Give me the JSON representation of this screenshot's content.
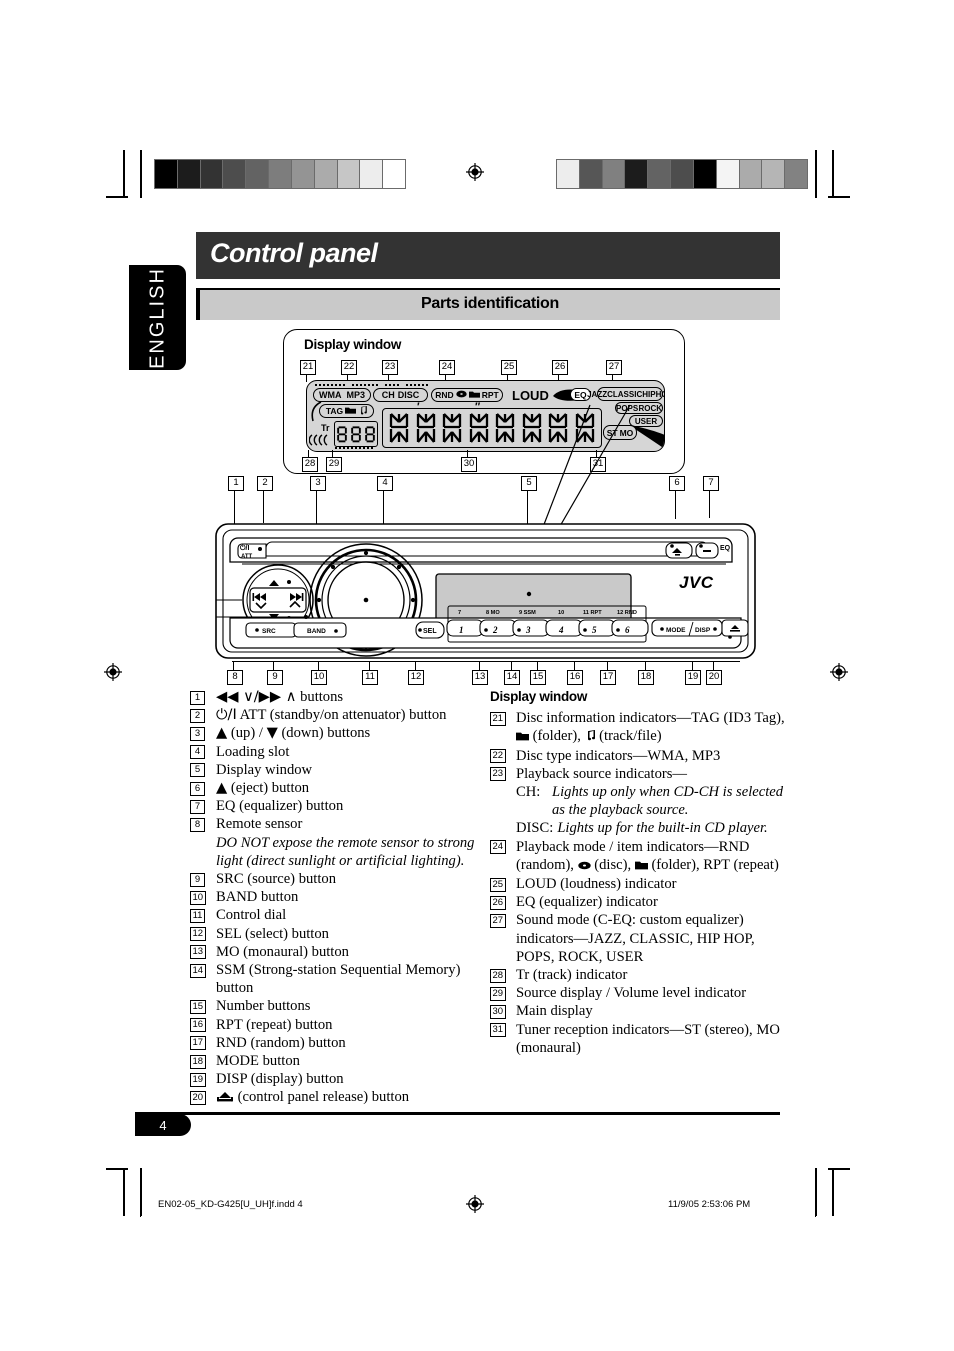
{
  "language_tab": "ENGLISH",
  "header": {
    "title": "Control panel",
    "section": "Parts identification"
  },
  "display_panel": {
    "heading": "Display window",
    "lcd": {
      "indicators_row1": [
        "WMA",
        "MP3",
        "CH",
        "DISC",
        "RND",
        "disc-icon",
        "folder-icon",
        "RPT",
        "LOUD",
        "EQ"
      ],
      "sound_modes": [
        "JAZZ",
        "CLASSIC",
        "HIPHOP",
        "POPS",
        "ROCK",
        "USER"
      ],
      "tag_row": [
        "TAG",
        "folder-icon",
        "note-icon"
      ],
      "track_label": "Tr",
      "source_digits": "888",
      "tuner_row": [
        "ST",
        "MO"
      ],
      "main_digits": "88:88.8888"
    },
    "callouts_top": [
      "21",
      "22",
      "23",
      "24",
      "25",
      "26",
      "27"
    ],
    "callouts_bottom": [
      "28",
      "29",
      "30",
      "31"
    ]
  },
  "faceplate": {
    "callouts_top": [
      "1",
      "2",
      "3",
      "4",
      "5",
      "6",
      "7"
    ],
    "callouts_bottom": [
      "8",
      "9",
      "10",
      "11",
      "12",
      "13",
      "14",
      "15",
      "16",
      "17",
      "18",
      "19",
      "20"
    ],
    "brand": "JVC",
    "power_label_top": "⏻/I",
    "power_label_bottom": "ATT",
    "eq_label": "EQ",
    "sel_label": "SEL",
    "src_label": "SRC",
    "band_label": "BAND",
    "mode_label": "MODE",
    "disp_label": "DISP",
    "preset_numbers": [
      "1",
      "2",
      "3",
      "4",
      "5",
      "6"
    ],
    "preset_upper_labels": [
      "7",
      "8  MO",
      "9  SSM",
      "10",
      "11  RPT",
      "12  RND"
    ]
  },
  "left_list": [
    {
      "n": "1",
      "text": "◀◀ ∨ / ▶▶ ∧ buttons",
      "glyph": true
    },
    {
      "n": "2",
      "text": "⏻/I ATT (standby/on attenuator) button"
    },
    {
      "n": "3",
      "text": "▲ (up) / ▼ (down) buttons"
    },
    {
      "n": "4",
      "text": "Loading slot"
    },
    {
      "n": "5",
      "text": "Display window"
    },
    {
      "n": "6",
      "text": "▲ (eject) button"
    },
    {
      "n": "7",
      "text": "EQ (equalizer) button"
    },
    {
      "n": "8",
      "text": "Remote sensor",
      "note": "DO NOT expose the remote sensor to strong light (direct sunlight or artificial lighting)."
    },
    {
      "n": "9",
      "text": "SRC (source) button"
    },
    {
      "n": "10",
      "text": "BAND button"
    },
    {
      "n": "11",
      "text": "Control dial"
    },
    {
      "n": "12",
      "text": "SEL (select) button"
    },
    {
      "n": "13",
      "text": "MO (monaural) button"
    },
    {
      "n": "14",
      "text": "SSM (Strong-station Sequential Memory) button"
    },
    {
      "n": "15",
      "text": "Number buttons"
    },
    {
      "n": "16",
      "text": "RPT (repeat) button"
    },
    {
      "n": "17",
      "text": "RND (random) button"
    },
    {
      "n": "18",
      "text": "MODE button"
    },
    {
      "n": "19",
      "text": "DISP (display) button"
    },
    {
      "n": "20",
      "text": "(control panel release) button"
    }
  ],
  "right_heading": "Display window",
  "right_list": [
    {
      "n": "21",
      "text": "Disc information indicators—TAG (ID3 Tag), ■ (folder), ♫ (track/file)"
    },
    {
      "n": "22",
      "text": "Disc type indicators—WMA, MP3"
    },
    {
      "n": "23",
      "text": "Playback source indicators—",
      "ch_label": "CH:",
      "ch_text": "Lights up only when CD-CH is selected as the playback source.",
      "disc_label": "DISC:",
      "disc_text": "Lights up for the built-in CD player."
    },
    {
      "n": "24",
      "text": "Playback mode / item indicators—RND (random), ● (disc), ■ (folder), RPT (repeat)"
    },
    {
      "n": "25",
      "text": "LOUD (loudness) indicator"
    },
    {
      "n": "26",
      "text": "EQ (equalizer) indicator"
    },
    {
      "n": "27",
      "text": "Sound mode (C-EQ: custom equalizer) indicators—JAZZ, CLASSIC, HIP HOP, POPS, ROCK, USER"
    },
    {
      "n": "28",
      "text": "Tr (track) indicator"
    },
    {
      "n": "29",
      "text": "Source display / Volume level indicator"
    },
    {
      "n": "30",
      "text": "Main display"
    },
    {
      "n": "31",
      "text": "Tuner reception indicators—ST (stereo), MO (monaural)"
    }
  ],
  "page_number": "4",
  "print_footer": {
    "file": "EN02-05_KD-G425[U_UH]f.indd   4",
    "datetime": "11/9/05   2:53:06 PM"
  },
  "calibration": {
    "left_swatches": [
      "#000000",
      "#1c1c1c",
      "#333333",
      "#4d4d4d",
      "#636363",
      "#7d7d7d",
      "#949494",
      "#ababab",
      "#c6c6c6",
      "#ededed",
      "#ffffff"
    ],
    "right_swatches": [
      "#ededed",
      "#565656",
      "#808080",
      "#1c1c1c",
      "#636363",
      "#4d4d4d",
      "#000000",
      "#f4f4f4",
      "#ababab",
      "#b5b5b5",
      "#828282"
    ]
  }
}
